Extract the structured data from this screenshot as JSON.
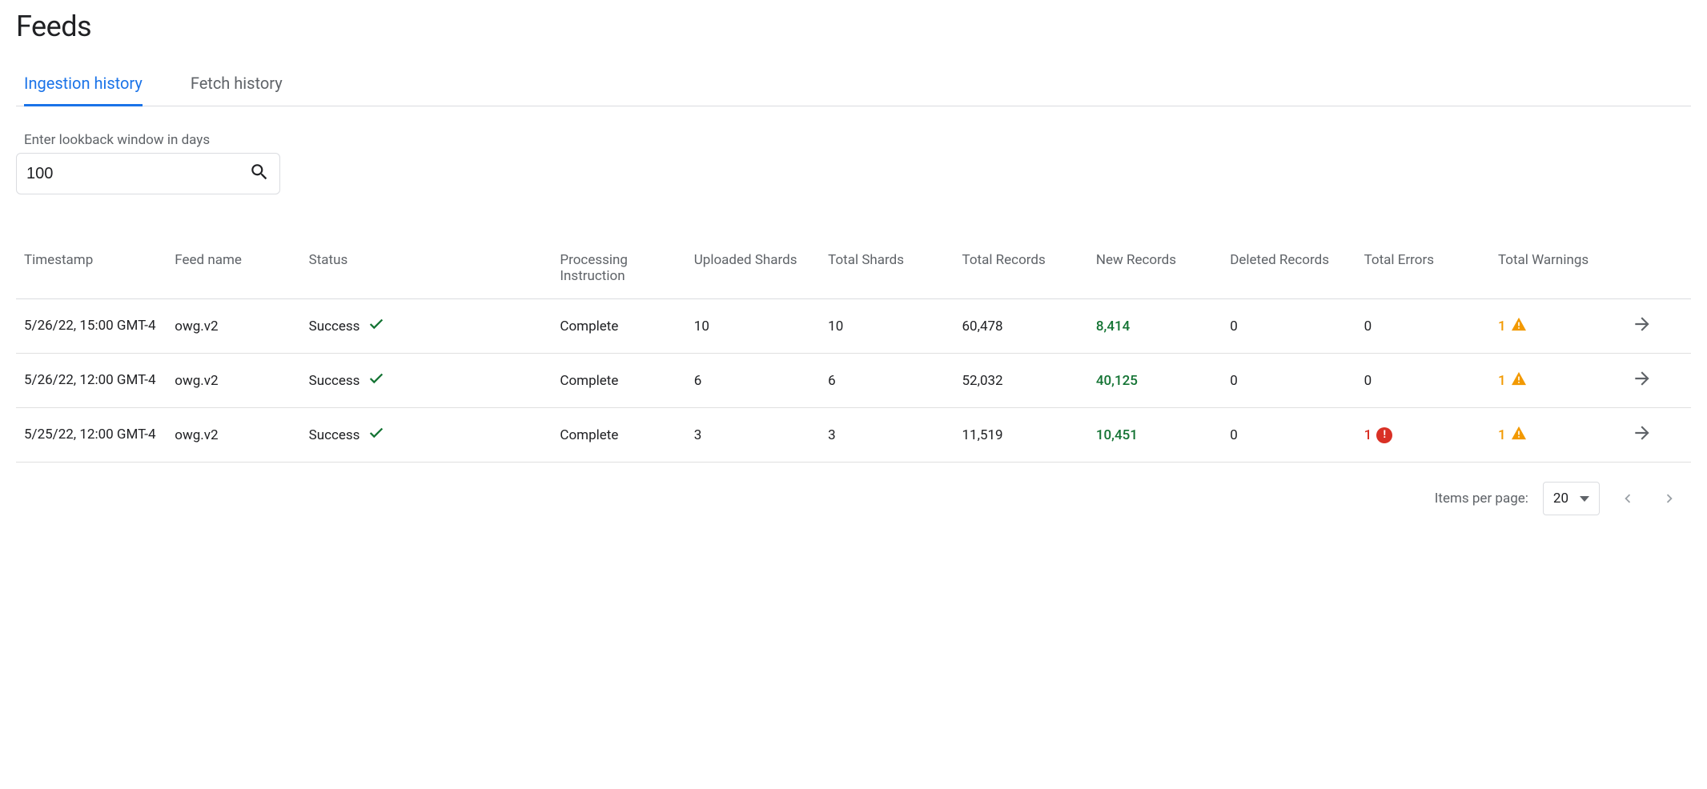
{
  "page": {
    "title": "Feeds"
  },
  "tabs": {
    "ingestion": "Ingestion history",
    "fetch": "Fetch history"
  },
  "lookback": {
    "label": "Enter lookback window in days",
    "value": "100"
  },
  "columns": {
    "timestamp": "Timestamp",
    "feed_name": "Feed name",
    "status": "Status",
    "processing": "Processing Instruction",
    "uploaded_shards": "Uploaded Shards",
    "total_shards": "Total Shards",
    "total_records": "Total Records",
    "new_records": "New Records",
    "deleted_records": "Deleted Records",
    "total_errors": "Total Errors",
    "total_warnings": "Total Warnings"
  },
  "rows": [
    {
      "timestamp": "5/26/22, 15:00 GMT-4",
      "feed_name": "owg.v2",
      "status": "Success",
      "processing": "Complete",
      "uploaded_shards": "10",
      "total_shards": "10",
      "total_records": "60,478",
      "new_records": "8,414",
      "deleted_records": "0",
      "total_errors": "0",
      "has_error_badge": false,
      "total_warnings": "1"
    },
    {
      "timestamp": "5/26/22, 12:00 GMT-4",
      "feed_name": "owg.v2",
      "status": "Success",
      "processing": "Complete",
      "uploaded_shards": "6",
      "total_shards": "6",
      "total_records": "52,032",
      "new_records": "40,125",
      "deleted_records": "0",
      "total_errors": "0",
      "has_error_badge": false,
      "total_warnings": "1"
    },
    {
      "timestamp": "5/25/22, 12:00 GMT-4",
      "feed_name": "owg.v2",
      "status": "Success",
      "processing": "Complete",
      "uploaded_shards": "3",
      "total_shards": "3",
      "total_records": "11,519",
      "new_records": "10,451",
      "deleted_records": "0",
      "total_errors": "1",
      "has_error_badge": true,
      "total_warnings": "1"
    }
  ],
  "pagination": {
    "label": "Items per page:",
    "page_size": "20"
  }
}
